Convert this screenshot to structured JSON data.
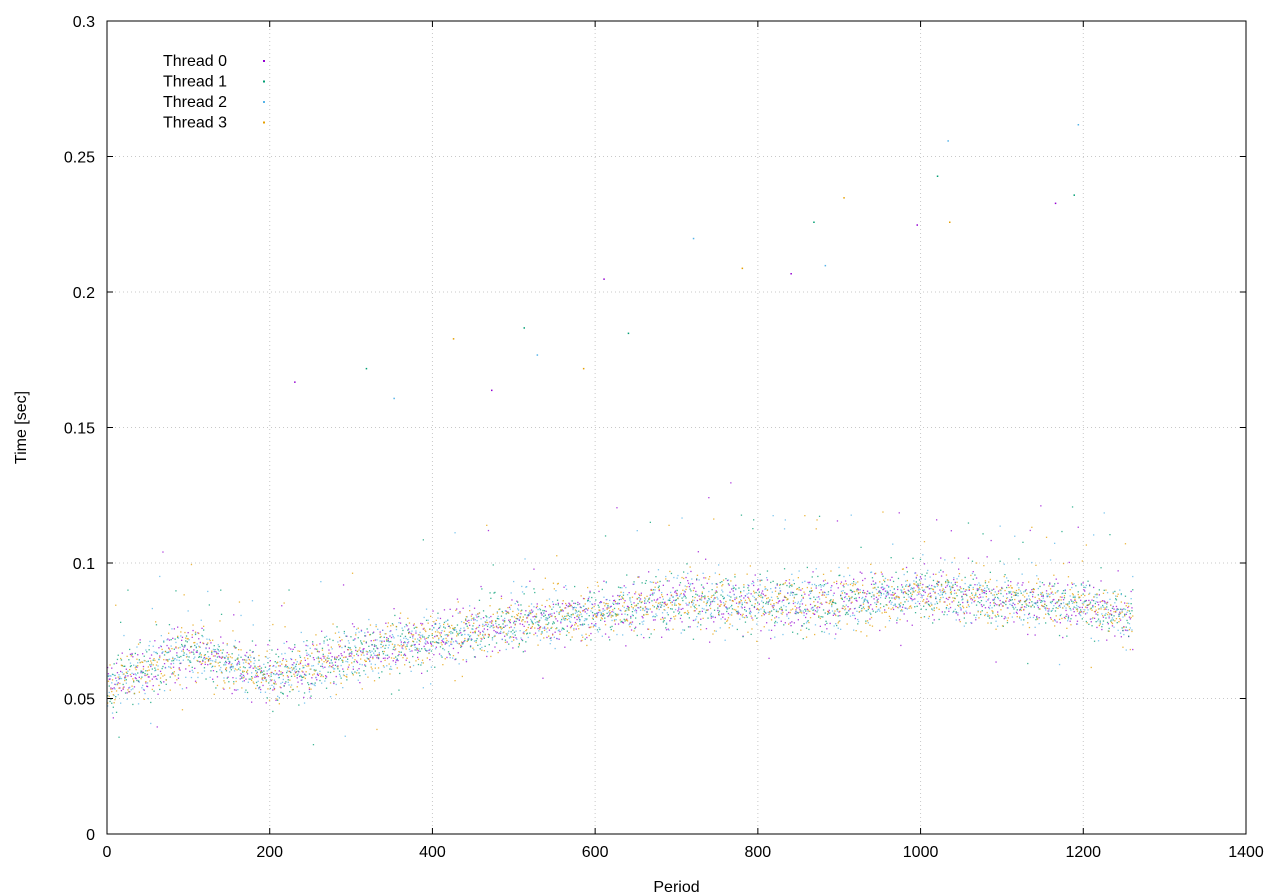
{
  "chart_data": {
    "type": "scatter",
    "title": "",
    "xlabel": "Period",
    "ylabel": "Time [sec]",
    "xlim": [
      0,
      1400
    ],
    "ylim": [
      0,
      0.3
    ],
    "x_ticks": [
      0,
      200,
      400,
      600,
      800,
      1000,
      1200,
      1400
    ],
    "x_tick_labels": [
      "0",
      "200",
      "400",
      "600",
      "800",
      "1000",
      "1200",
      "1400"
    ],
    "y_ticks": [
      0,
      0.05,
      0.1,
      0.15,
      0.2,
      0.25,
      0.3
    ],
    "y_tick_labels": [
      "0",
      "0.05",
      "0.1",
      "0.15",
      "0.2",
      "0.25",
      "0.3"
    ],
    "grid": true,
    "legend_position": "top-left",
    "series": [
      {
        "name": "Thread 0",
        "color": "#9400d3"
      },
      {
        "name": "Thread 1",
        "color": "#009e73"
      },
      {
        "name": "Thread 2",
        "color": "#56b4e9"
      },
      {
        "name": "Thread 3",
        "color": "#e69f00"
      }
    ],
    "x_range_observed": [
      0,
      1260
    ],
    "trend": {
      "x": [
        0,
        100,
        200,
        300,
        400,
        500,
        600,
        700,
        800,
        900,
        1000,
        1100,
        1200,
        1260
      ],
      "y": [
        0.055,
        0.068,
        0.058,
        0.066,
        0.072,
        0.079,
        0.082,
        0.087,
        0.086,
        0.086,
        0.089,
        0.086,
        0.085,
        0.08
      ]
    },
    "outliers": [
      {
        "x": 230,
        "y": 0.167
      },
      {
        "x": 318,
        "y": 0.172
      },
      {
        "x": 352,
        "y": 0.161
      },
      {
        "x": 425,
        "y": 0.183
      },
      {
        "x": 472,
        "y": 0.164
      },
      {
        "x": 512,
        "y": 0.187
      },
      {
        "x": 528,
        "y": 0.177
      },
      {
        "x": 585,
        "y": 0.172
      },
      {
        "x": 610,
        "y": 0.205
      },
      {
        "x": 640,
        "y": 0.185
      },
      {
        "x": 720,
        "y": 0.22
      },
      {
        "x": 780,
        "y": 0.209
      },
      {
        "x": 840,
        "y": 0.207
      },
      {
        "x": 868,
        "y": 0.226
      },
      {
        "x": 882,
        "y": 0.21
      },
      {
        "x": 905,
        "y": 0.235
      },
      {
        "x": 995,
        "y": 0.225
      },
      {
        "x": 1020,
        "y": 0.243
      },
      {
        "x": 1033,
        "y": 0.256
      },
      {
        "x": 1035,
        "y": 0.226
      },
      {
        "x": 1165,
        "y": 0.233
      },
      {
        "x": 1188,
        "y": 0.236
      },
      {
        "x": 1193,
        "y": 0.262
      }
    ]
  }
}
